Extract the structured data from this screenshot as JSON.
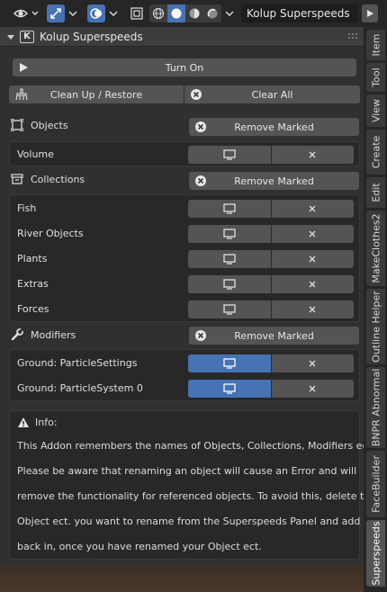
{
  "header": {
    "scene_name": "Kolup Superspeeds"
  },
  "panel": {
    "title": "Kolup Superspeeds",
    "turn_on_label": "Turn On",
    "cleanup_label": "Clean Up / Restore",
    "clear_all_label": "Clear All",
    "objects": {
      "label": "Objects",
      "remove_label": "Remove Marked",
      "items": [
        "Volume"
      ]
    },
    "collections": {
      "label": "Collections",
      "remove_label": "Remove Marked",
      "items": [
        "Fish",
        "River Objects",
        "Plants",
        "Extras",
        "Forces"
      ]
    },
    "modifiers": {
      "label": "Modifiers",
      "remove_label": "Remove Marked",
      "items": [
        "Ground: ParticleSettings",
        "Ground: ParticleSystem 0"
      ]
    },
    "info": {
      "title": "Info:",
      "lines": [
        "This Addon remembers the names of Objects, Collections, Modifiers ect.",
        "Please be aware that renaming an object will cause an Error and will",
        "remove the functionality for referenced objects. To avoid this, delete the",
        "Object ect. you want to rename from the Superspeeds Panel and add it",
        "back in, once you have renamed your Object ect."
      ]
    }
  },
  "tabs": [
    "Item",
    "Tool",
    "View",
    "Create",
    "Edit",
    "MakeClothes2",
    "Outline Helper",
    "BNPR Abnormal",
    "FaceBuilder",
    "Superspeeds"
  ],
  "colors": {
    "accent": "#4772b3",
    "button": "#545454",
    "panel_bg": "#303030",
    "box_bg": "#282828"
  }
}
